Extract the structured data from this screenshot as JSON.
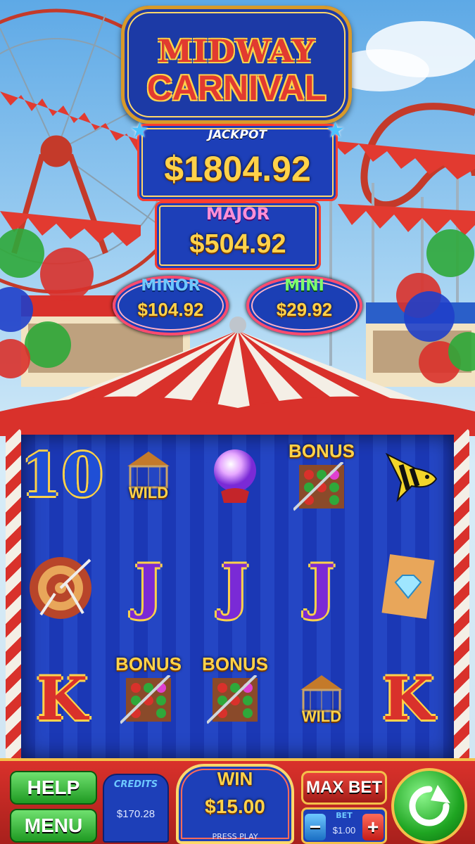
{
  "title": {
    "line1": "MIDWAY",
    "line2": "CARNIVAL"
  },
  "jackpots": {
    "jackpot": {
      "label": "JACKPOT",
      "value": "$1804.92"
    },
    "major": {
      "label": "MAJOR",
      "value": "$504.92"
    },
    "minor": {
      "label": "MINOR",
      "value": "$104.92"
    },
    "mini": {
      "label": "MINI",
      "value": "$29.92"
    }
  },
  "reels": {
    "rows": [
      [
        {
          "icon": "ten-symbol",
          "label": "10"
        },
        {
          "icon": "carousel-wild-symbol",
          "label": "WILD"
        },
        {
          "icon": "crystal-ball-symbol",
          "label": ""
        },
        {
          "icon": "bonus-dart-board-symbol",
          "label": "BONUS"
        },
        {
          "icon": "angelfish-symbol",
          "label": ""
        }
      ],
      [
        {
          "icon": "dart-target-symbol",
          "label": ""
        },
        {
          "icon": "jack-symbol",
          "label": "J"
        },
        {
          "icon": "jack-symbol",
          "label": "J"
        },
        {
          "icon": "jack-symbol",
          "label": "J"
        },
        {
          "icon": "diamond-ticket-symbol",
          "label": ""
        }
      ],
      [
        {
          "icon": "king-symbol",
          "label": "K"
        },
        {
          "icon": "bonus-dart-board-symbol",
          "label": "BONUS"
        },
        {
          "icon": "bonus-dart-board-symbol",
          "label": "BONUS"
        },
        {
          "icon": "carousel-wild-symbol",
          "label": "WILD"
        },
        {
          "icon": "king-symbol",
          "label": "K"
        }
      ]
    ]
  },
  "controls": {
    "help": "HELP",
    "menu": "MENU",
    "credits_label": "CREDITS",
    "credits_value": "$170.28",
    "win_label": "WIN",
    "win_value": "$15.00",
    "press_play": "PRESS PLAY",
    "max_bet": "MAX BET",
    "bet_label": "BET",
    "bet_value": "$1.00",
    "bet_minus": "−",
    "bet_plus": "+"
  },
  "colors": {
    "accent_gold": "#ffd24a",
    "panel_blue": "#1d3fb8",
    "tent_red": "#d9312b",
    "button_green": "#2fbf2f"
  }
}
